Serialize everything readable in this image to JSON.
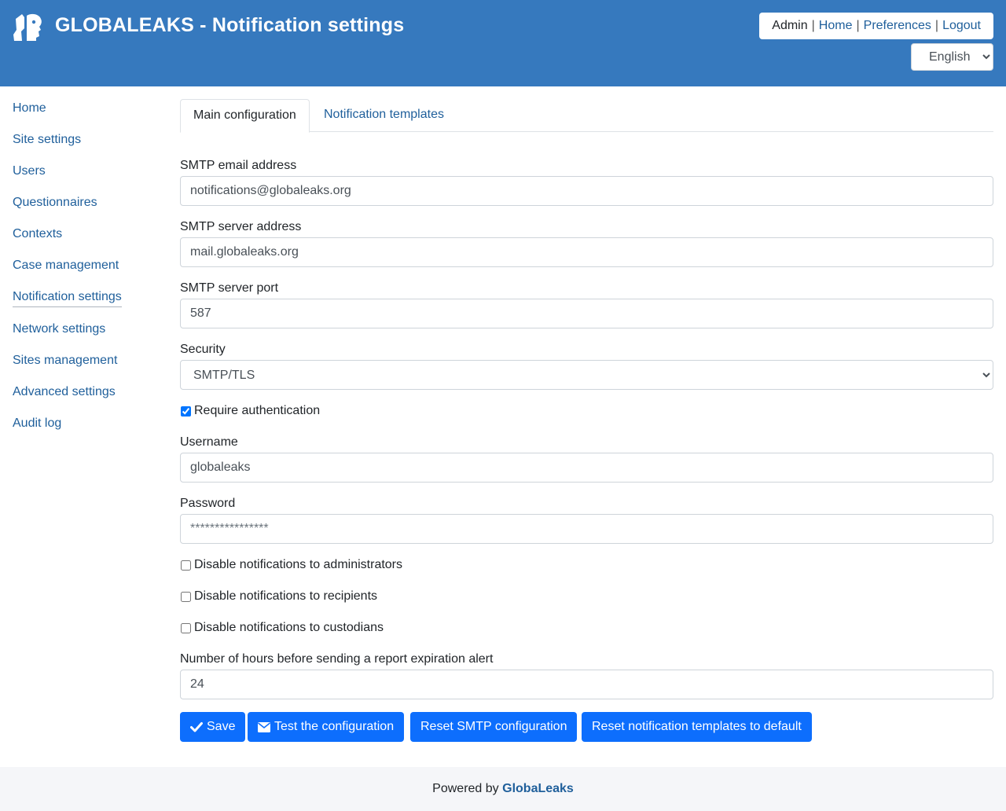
{
  "header": {
    "title": "GLOBALEAKS - Notification settings",
    "user_role": "Admin",
    "links": {
      "home": "Home",
      "preferences": "Preferences",
      "logout": "Logout"
    },
    "separator": "|",
    "language": "English",
    "logo_icon": "globaleaks-logo-icon"
  },
  "sidebar": {
    "items": [
      {
        "label": "Home"
      },
      {
        "label": "Site settings"
      },
      {
        "label": "Users"
      },
      {
        "label": "Questionnaires"
      },
      {
        "label": "Contexts"
      },
      {
        "label": "Case management"
      },
      {
        "label": "Notification settings",
        "active": true
      },
      {
        "label": "Network settings"
      },
      {
        "label": "Sites management"
      },
      {
        "label": "Advanced settings"
      },
      {
        "label": "Audit log"
      }
    ]
  },
  "tabs": [
    {
      "label": "Main configuration",
      "active": true
    },
    {
      "label": "Notification templates"
    }
  ],
  "form": {
    "smtp_email": {
      "label": "SMTP email address",
      "value": "notifications@globaleaks.org"
    },
    "smtp_server": {
      "label": "SMTP server address",
      "value": "mail.globaleaks.org"
    },
    "smtp_port": {
      "label": "SMTP server port",
      "value": "587"
    },
    "security": {
      "label": "Security",
      "value": "SMTP/TLS"
    },
    "require_auth": {
      "label": "Require authentication",
      "checked": true
    },
    "username": {
      "label": "Username",
      "value": "globaleaks"
    },
    "password": {
      "label": "Password",
      "placeholder": "****************"
    },
    "disable_admins": {
      "label": "Disable notifications to administrators",
      "checked": false
    },
    "disable_recipients": {
      "label": "Disable notifications to recipients",
      "checked": false
    },
    "disable_custodians": {
      "label": "Disable notifications to custodians",
      "checked": false
    },
    "expiration_hours": {
      "label": "Number of hours before sending a report expiration alert",
      "value": "24"
    }
  },
  "buttons": {
    "save": "Save",
    "test": "Test the configuration",
    "reset_smtp": "Reset SMTP configuration",
    "reset_templates": "Reset notification templates to default"
  },
  "footer": {
    "text": "Powered by",
    "brand": "GlobaLeaks"
  },
  "colors": {
    "header_bg": "#3679be",
    "link": "#1f5f9b",
    "primary": "#0d6efd",
    "footer_bg": "#f5f6f9"
  }
}
